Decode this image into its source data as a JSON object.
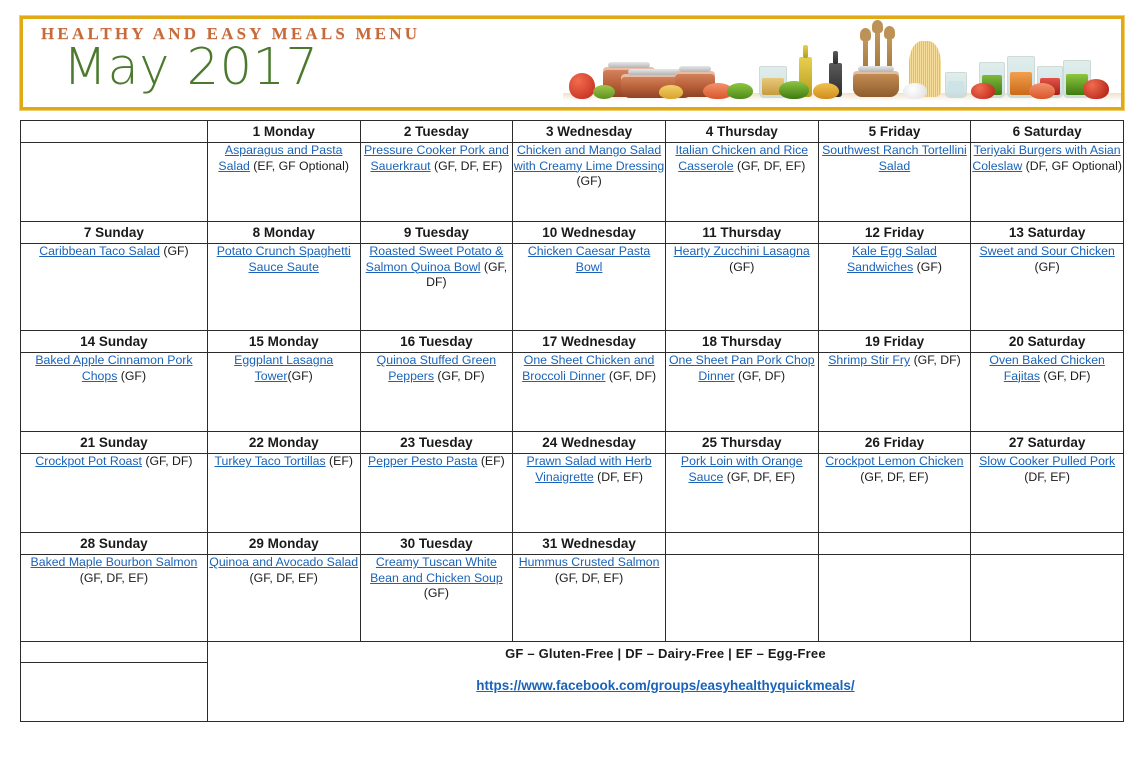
{
  "banner": {
    "kicker": "HEALTHY AND EASY MEALS MENU",
    "month": "May 2017",
    "photo_alt": "cookware-vegetables-utensils-jars-photo",
    "border_color": "#e0a915",
    "kicker_color": "#c8693a",
    "month_color": "#4b7a2e"
  },
  "calendar": {
    "link_color": "#1a63b8",
    "corner_label": "",
    "weekday_order": [
      "Sunday",
      "Monday",
      "Tuesday",
      "Wednesday",
      "Thursday",
      "Friday",
      "Saturday"
    ],
    "weeks": [
      {
        "headers": [
          "",
          "1 Monday",
          "2 Tuesday",
          "3 Wednesday",
          "4 Thursday",
          "5 Friday",
          "6 Saturday"
        ],
        "cells": [
          {
            "link": "",
            "tag": ""
          },
          {
            "link": "Asparagus and Pasta Salad",
            "tag": " (EF, GF Optional)"
          },
          {
            "link": "Pressure Cooker Pork and Sauerkraut",
            "tag": " (GF, DF, EF)"
          },
          {
            "link": "Chicken and Mango Salad with Creamy Lime Dressing",
            "tag": " (GF)"
          },
          {
            "link": "Italian Chicken and Rice Casserole",
            "tag": " (GF, DF, EF)"
          },
          {
            "link": "Southwest Ranch Tortellini Salad",
            "tag": ""
          },
          {
            "link": "Teriyaki Burgers with Asian Coleslaw",
            "tag": " (DF, GF Optional)"
          }
        ]
      },
      {
        "headers": [
          "7 Sunday",
          "8 Monday",
          "9 Tuesday",
          "10 Wednesday",
          "11 Thursday",
          "12 Friday",
          "13 Saturday"
        ],
        "cells": [
          {
            "link": "Caribbean Taco Salad",
            "tag": " (GF)"
          },
          {
            "link": "Potato Crunch Spaghetti Sauce Saute",
            "tag": ""
          },
          {
            "link": "Roasted Sweet Potato & Salmon Quinoa Bowl",
            "tag": " (GF, DF)"
          },
          {
            "link": "Chicken Caesar Pasta Bowl",
            "tag": ""
          },
          {
            "link": "Hearty Zucchini Lasagna",
            "tag": " (GF)"
          },
          {
            "link": "Kale Egg Salad Sandwiches",
            "tag": " (GF)"
          },
          {
            "link": "Sweet and Sour Chicken",
            "tag": " (GF)"
          }
        ]
      },
      {
        "headers": [
          "14 Sunday",
          "15 Monday",
          "16 Tuesday",
          "17 Wednesday",
          "18 Thursday",
          "19 Friday",
          "20 Saturday"
        ],
        "cells": [
          {
            "link": "Baked Apple Cinnamon Pork Chops",
            "tag": " (GF)"
          },
          {
            "link": "Eggplant Lasagna Tower",
            "tag": "(GF)"
          },
          {
            "link": "Quinoa Stuffed Green Peppers",
            "tag": " (GF, DF)"
          },
          {
            "link": "One Sheet Chicken and Broccoli Dinner",
            "tag": " (GF, DF)"
          },
          {
            "link": "One Sheet Pan Pork Chop Dinner",
            "tag": " (GF, DF)"
          },
          {
            "link": "Shrimp Stir Fry",
            "tag": " (GF, DF)"
          },
          {
            "link": "Oven Baked Chicken Fajitas",
            "tag": " (GF, DF)"
          }
        ]
      },
      {
        "headers": [
          "21 Sunday",
          "22 Monday",
          "23 Tuesday",
          "24 Wednesday",
          "25 Thursday",
          "26 Friday",
          "27 Saturday"
        ],
        "cells": [
          {
            "link": "Crockpot Pot Roast",
            "tag": " (GF, DF)"
          },
          {
            "link": "Turkey Taco Tortillas",
            "tag": " (EF)"
          },
          {
            "link": "Pepper Pesto Pasta",
            "tag": " (EF)"
          },
          {
            "link": "Prawn Salad with Herb Vinaigrette",
            "tag": " (DF, EF)"
          },
          {
            "link": "Pork Loin with Orange Sauce",
            "tag": " (GF, DF, EF)"
          },
          {
            "link": "Crockpot Lemon Chicken",
            "tag": " (GF, DF, EF)"
          },
          {
            "link": "Slow Cooker Pulled Pork",
            "tag": " (DF, EF)"
          }
        ]
      },
      {
        "headers": [
          "28 Sunday",
          "29 Monday",
          "30 Tuesday",
          "31 Wednesday",
          "",
          "",
          ""
        ],
        "cells": [
          {
            "link": "Baked Maple Bourbon Salmon",
            "tag": " (GF, DF, EF)"
          },
          {
            "link": "Quinoa and Avocado Salad",
            "tag": " (GF, DF, EF)"
          },
          {
            "link": "Creamy Tuscan White Bean and Chicken Soup",
            "tag": " (GF)"
          },
          {
            "link": "Hummus Crusted Salmon",
            "tag": " (GF, DF, EF)"
          },
          {
            "link": "",
            "tag": ""
          },
          {
            "link": "",
            "tag": ""
          },
          {
            "link": "",
            "tag": ""
          }
        ]
      }
    ]
  },
  "footer": {
    "legend": "GF – Gluten-Free  |  DF – Dairy-Free  |  EF – Egg-Free",
    "facebook_url": "https://www.facebook.com/groups/easyhealthyquickmeals/"
  }
}
